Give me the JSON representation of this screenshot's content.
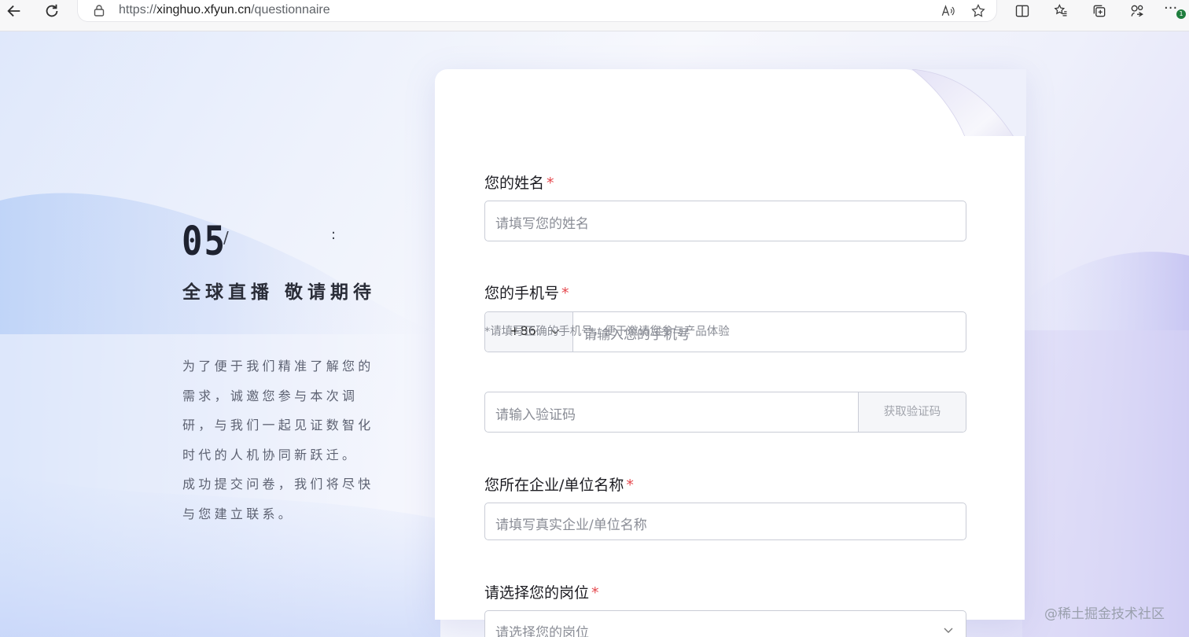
{
  "browser": {
    "url_scheme": "https://",
    "url_host": "xinghuo.xfyun.cn",
    "url_path": "/questionnaire",
    "profile_badge": "1"
  },
  "hero": {
    "number": "05",
    "slash": "/",
    "colon": ":",
    "title": "全球直播 敬请期待",
    "desc_line1": "为了便于我们精准了解您的需求，诚邀您参与本次调研，与我们一起见证数智化时代的人机协同新跃迁。",
    "desc_line2": "成功提交问卷，我们将尽快与您建立联系。"
  },
  "form": {
    "name": {
      "label": "您的姓名",
      "required": "*",
      "placeholder": "请填写您的姓名"
    },
    "phone": {
      "label": "您的手机号",
      "required": "*",
      "country_code": "+86",
      "placeholder": "请输入您的手机号",
      "hint": "*请填写正确的手机号，便于邀请您参与产品体验"
    },
    "verify": {
      "placeholder": "请输入验证码",
      "button": "获取验证码"
    },
    "company": {
      "label": "您所在企业/单位名称",
      "required": "*",
      "placeholder": "请填写真实企业/单位名称"
    },
    "position": {
      "label": "请选择您的岗位",
      "required": "*",
      "placeholder": "请选择您的岗位"
    }
  },
  "watermark": "@稀土掘金技术社区",
  "colors": {
    "required": "#e5484d",
    "card": "#ffffff",
    "border": "#c9ccd6"
  }
}
